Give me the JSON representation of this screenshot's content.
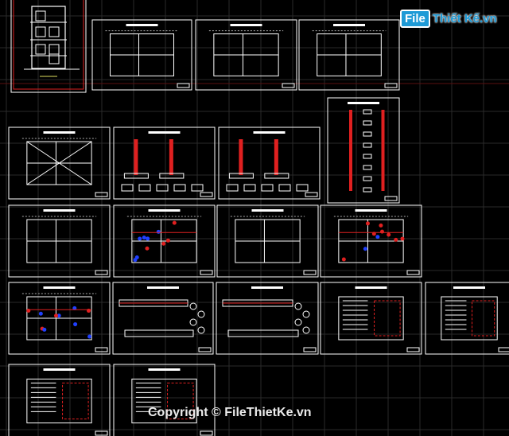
{
  "logo": {
    "badge": "File",
    "text": "Thiết Kế.vn",
    "color": "#1e9ad6"
  },
  "watermark": {
    "copyright": "Copyright © FileThietKe.vn"
  },
  "colors": {
    "background": "#000000",
    "grid": "#2a2a2a",
    "frame": "#ffffff",
    "accent_red": "#e02020",
    "accent_blue": "#2040ff",
    "label_yellow": "#e0e060"
  }
}
